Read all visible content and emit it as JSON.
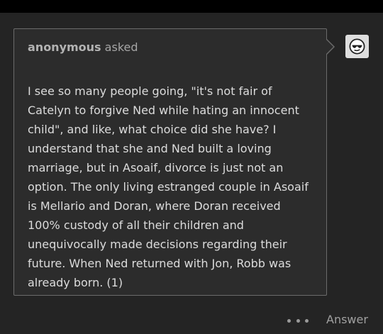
{
  "ask": {
    "asker_name": "anonymous",
    "asked_label": "asked",
    "question": "I see so many people going, \"it's not fair of Catelyn to forgive Ned while hating an innocent child\", and like, what choice did she have? I understand that she and Ned built a loving marriage, but in Asoaif, divorce is just not an option. The only living estranged couple in Asoaif is Mellario and Doran, where Doran received 100% custody of all their children and unequivocally made decisions regarding their future. When Ned returned with Jon, Robb was already born. (1)"
  },
  "actions": {
    "answer_label": "Answer",
    "more_icon": "more-dots-icon"
  },
  "avatar": {
    "icon": "anonymous-sunglasses-face-icon"
  },
  "colors": {
    "background": "#242424",
    "card_background": "#2c2c2c",
    "card_border": "#6b6b6b",
    "text": "#dcdcdc",
    "muted_text": "#a6a6a6"
  }
}
